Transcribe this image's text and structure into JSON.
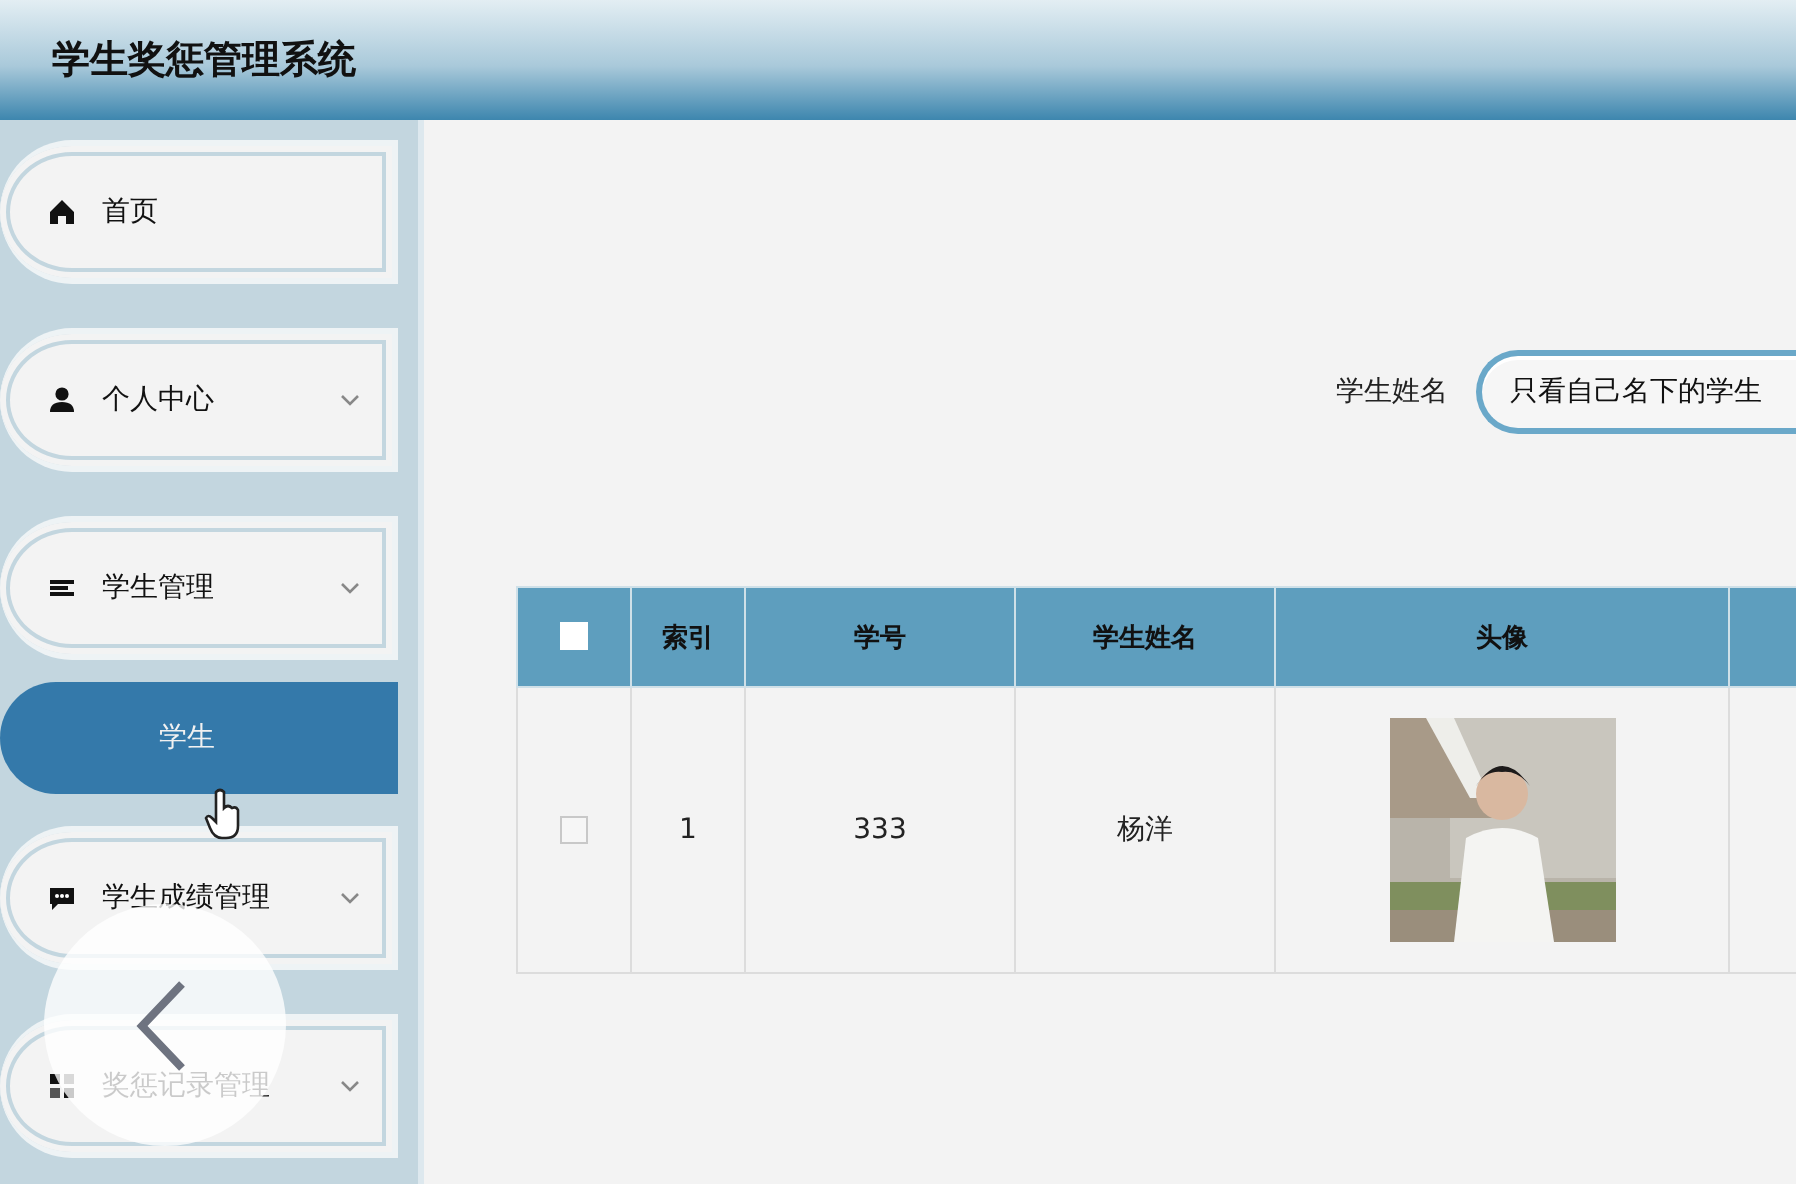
{
  "header": {
    "title": "学生奖惩管理系统"
  },
  "sidebar": {
    "items": [
      {
        "label": "首页",
        "kind": "link"
      },
      {
        "label": "个人中心",
        "kind": "group"
      },
      {
        "label": "学生管理",
        "kind": "group",
        "children": [
          {
            "label": "学生",
            "selected": true
          }
        ]
      },
      {
        "label": "学生成绩管理",
        "kind": "group"
      },
      {
        "label": "奖惩记录管理",
        "kind": "group"
      }
    ]
  },
  "search": {
    "label": "学生姓名",
    "placeholder": "只看自己名下的学生"
  },
  "table": {
    "header_checkbox": {
      "checked": false
    },
    "columns": [
      "索引",
      "学号",
      "学生姓名",
      "头像"
    ],
    "rows": [
      {
        "checked": false,
        "cells": [
          "1",
          "333",
          "杨洋"
        ],
        "avatar": {
          "kind": "picture"
        }
      }
    ]
  }
}
